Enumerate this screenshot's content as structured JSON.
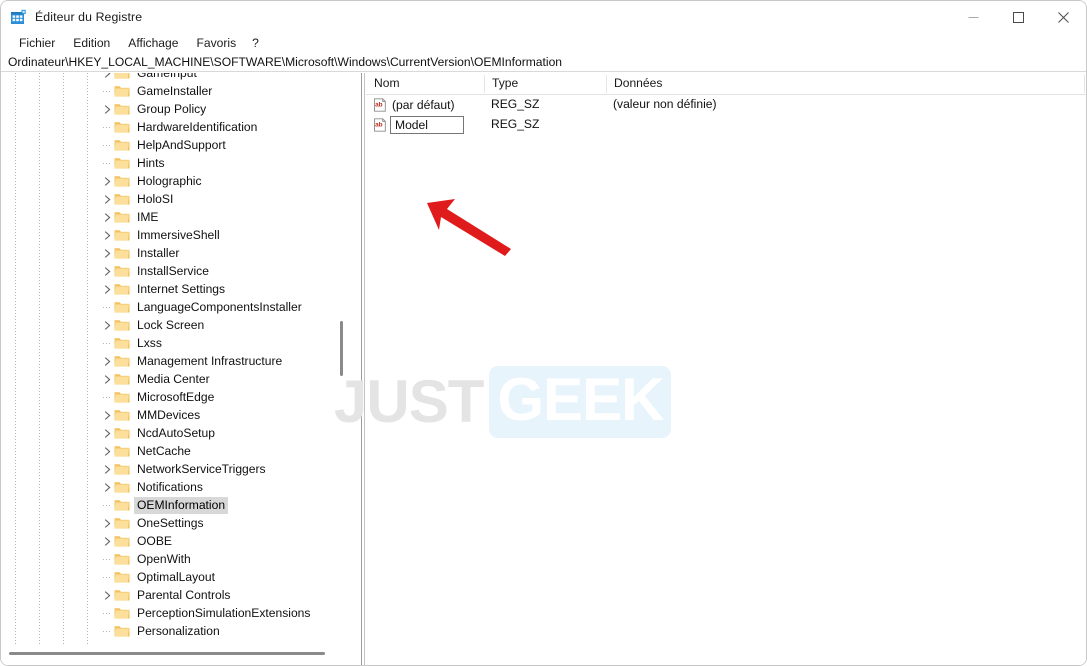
{
  "window": {
    "title": "Éditeur du Registre",
    "icon": "registry-editor-icon",
    "controls": {
      "minimize": "minimize-icon",
      "maximize": "maximize-icon",
      "close": "close-icon"
    }
  },
  "menubar": {
    "items": [
      {
        "label": "Fichier"
      },
      {
        "label": "Edition"
      },
      {
        "label": "Affichage"
      },
      {
        "label": "Favoris"
      },
      {
        "label": "?"
      }
    ]
  },
  "address": {
    "path": "Ordinateur\\HKEY_LOCAL_MACHINE\\SOFTWARE\\Microsoft\\Windows\\CurrentVersion\\OEMInformation"
  },
  "tree": {
    "items": [
      {
        "label": "GameInput",
        "expandable": true,
        "selected": false
      },
      {
        "label": "GameInstaller",
        "expandable": false,
        "selected": false
      },
      {
        "label": "Group Policy",
        "expandable": true,
        "selected": false
      },
      {
        "label": "HardwareIdentification",
        "expandable": false,
        "selected": false
      },
      {
        "label": "HelpAndSupport",
        "expandable": false,
        "selected": false
      },
      {
        "label": "Hints",
        "expandable": false,
        "selected": false
      },
      {
        "label": "Holographic",
        "expandable": true,
        "selected": false
      },
      {
        "label": "HoloSI",
        "expandable": true,
        "selected": false
      },
      {
        "label": "IME",
        "expandable": true,
        "selected": false
      },
      {
        "label": "ImmersiveShell",
        "expandable": true,
        "selected": false
      },
      {
        "label": "Installer",
        "expandable": true,
        "selected": false
      },
      {
        "label": "InstallService",
        "expandable": true,
        "selected": false
      },
      {
        "label": "Internet Settings",
        "expandable": true,
        "selected": false
      },
      {
        "label": "LanguageComponentsInstaller",
        "expandable": false,
        "selected": false
      },
      {
        "label": "Lock Screen",
        "expandable": true,
        "selected": false
      },
      {
        "label": "Lxss",
        "expandable": false,
        "selected": false
      },
      {
        "label": "Management Infrastructure",
        "expandable": true,
        "selected": false
      },
      {
        "label": "Media Center",
        "expandable": true,
        "selected": false
      },
      {
        "label": "MicrosoftEdge",
        "expandable": false,
        "selected": false
      },
      {
        "label": "MMDevices",
        "expandable": true,
        "selected": false
      },
      {
        "label": "NcdAutoSetup",
        "expandable": true,
        "selected": false
      },
      {
        "label": "NetCache",
        "expandable": true,
        "selected": false
      },
      {
        "label": "NetworkServiceTriggers",
        "expandable": true,
        "selected": false
      },
      {
        "label": "Notifications",
        "expandable": true,
        "selected": false
      },
      {
        "label": "OEMInformation",
        "expandable": false,
        "selected": true
      },
      {
        "label": "OneSettings",
        "expandable": true,
        "selected": false
      },
      {
        "label": "OOBE",
        "expandable": true,
        "selected": false
      },
      {
        "label": "OpenWith",
        "expandable": false,
        "selected": false
      },
      {
        "label": "OptimalLayout",
        "expandable": false,
        "selected": false
      },
      {
        "label": "Parental Controls",
        "expandable": true,
        "selected": false
      },
      {
        "label": "PerceptionSimulationExtensions",
        "expandable": false,
        "selected": false
      },
      {
        "label": "Personalization",
        "expandable": false,
        "selected": false
      }
    ]
  },
  "values": {
    "columns": [
      {
        "label": "Nom"
      },
      {
        "label": "Type"
      },
      {
        "label": "Données"
      }
    ],
    "rows": [
      {
        "name": "(par défaut)",
        "type": "REG_SZ",
        "data": "(valeur non définie)",
        "icon": "string-value-icon",
        "editing": false
      },
      {
        "name": "Model",
        "type": "REG_SZ",
        "data": "",
        "icon": "string-value-icon",
        "editing": true
      }
    ]
  },
  "watermark": {
    "part1": "JUST",
    "part2": "GEEK"
  },
  "annotation": {
    "arrow": "red-arrow-pointing-to-model-field"
  },
  "colors": {
    "accent_red": "#e01b1b",
    "folder_yellow": "#fdd67a",
    "selection_gray": "#d8d8d8",
    "watermark_gray": "#e4e4e4",
    "watermark_blue": "#e8f4fc"
  }
}
